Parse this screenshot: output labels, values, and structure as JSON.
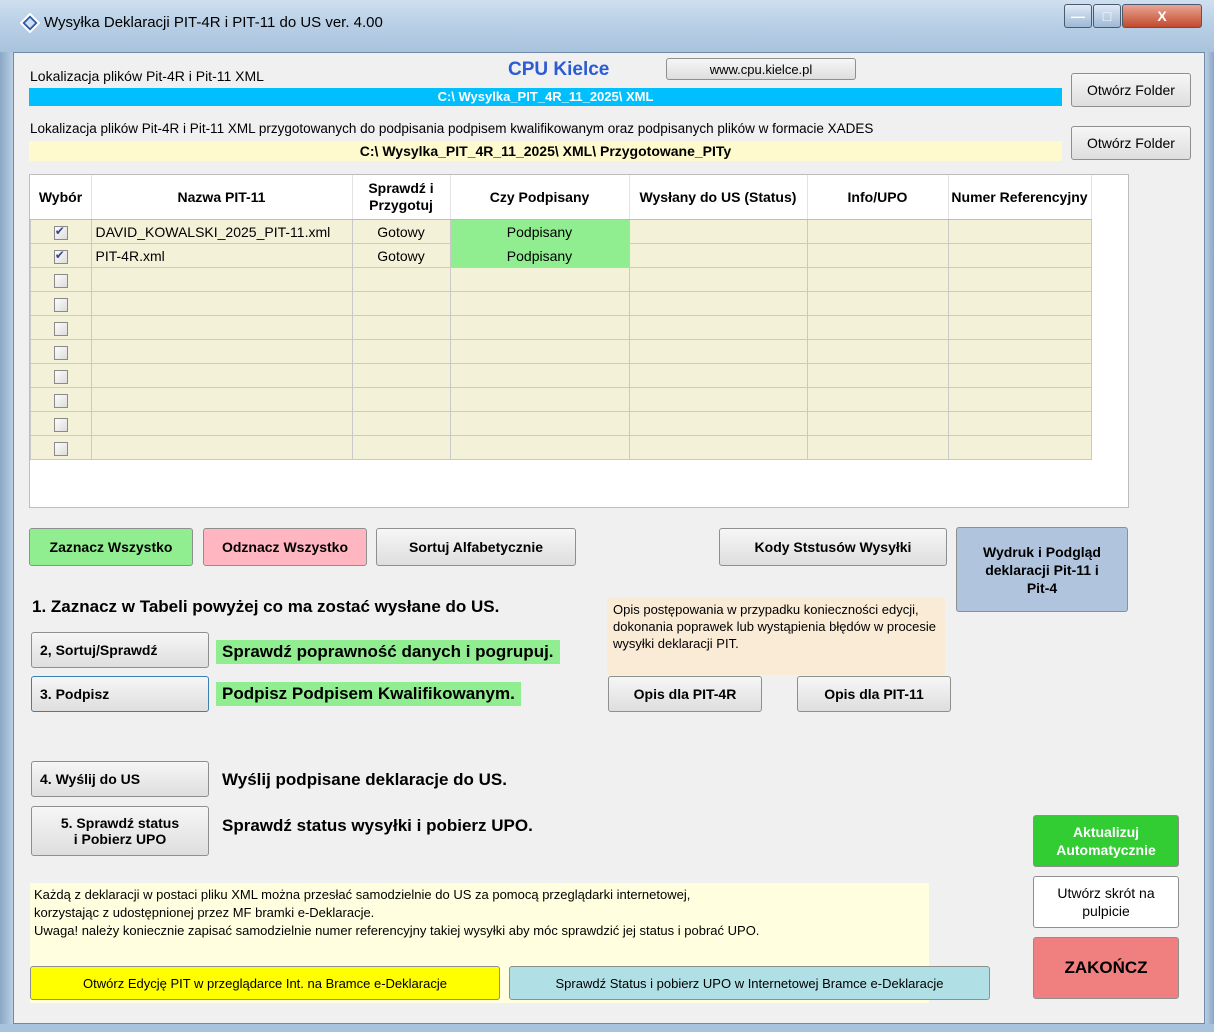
{
  "window": {
    "title": "Wysyłka Deklaracji PIT-4R i PIT-11 do US   ver. 4.00"
  },
  "header": {
    "brand": "CPU  Kielce",
    "website_button": "www.cpu.kielce.pl"
  },
  "paths": {
    "xml_label": "Lokalizacja plików Pit-4R i Pit-11 XML",
    "xml_path": "C:\\  Wysylka_PIT_4R_11_2025\\  XML",
    "signed_label": "Lokalizacja plików Pit-4R i Pit-11 XML przygotowanych do podpisania podpisem kwalifikowanym oraz podpisanych plików w formacie XADES",
    "signed_path": "C:\\  Wysylka_PIT_4R_11_2025\\  XML\\  Przygotowane_PITy",
    "open_folder_1": "Otwórz Folder",
    "open_folder_2": "Otwórz Folder"
  },
  "table": {
    "headers": {
      "wybor": "Wybór",
      "nazwa": "Nazwa PIT-11",
      "sprawdz": "Sprawdź i Przygotuj",
      "podpisany": "Czy Podpisany",
      "wyslany": "Wysłany do US (Status)",
      "info": "Info/UPO",
      "numer": "Numer Referencyjny"
    },
    "rows": [
      {
        "checked": true,
        "name": "DAVID_KOWALSKI_2025_PIT-11.xml",
        "prepared": "Gotowy",
        "signed": "Podpisany"
      },
      {
        "checked": true,
        "name": "PIT-4R.xml",
        "prepared": "Gotowy",
        "signed": "Podpisany"
      },
      {
        "checked": false,
        "name": "",
        "prepared": "",
        "signed": ""
      },
      {
        "checked": false,
        "name": "",
        "prepared": "",
        "signed": ""
      },
      {
        "checked": false,
        "name": "",
        "prepared": "",
        "signed": ""
      },
      {
        "checked": false,
        "name": "",
        "prepared": "",
        "signed": ""
      },
      {
        "checked": false,
        "name": "",
        "prepared": "",
        "signed": ""
      },
      {
        "checked": false,
        "name": "",
        "prepared": "",
        "signed": ""
      },
      {
        "checked": false,
        "name": "",
        "prepared": "",
        "signed": ""
      },
      {
        "checked": false,
        "name": "",
        "prepared": "",
        "signed": ""
      }
    ]
  },
  "buttons": {
    "select_all": "Zaznacz Wszystko",
    "deselect_all": "Odznacz Wszystko",
    "sort_alpha": "Sortuj Alfabetycznie",
    "status_codes": "Kody Ststusów Wysyłki",
    "print_preview": "Wydruk i Podgląd deklaracji Pit-11  i  Pit-4",
    "step2": "2,  Sortuj/Sprawdź",
    "step3": "3.  Podpisz",
    "step4": "4.  Wyślij do US",
    "step5": "5.  Sprawdź status i  Pobierz UPO",
    "desc_pit4r": "Opis dla PIT-4R",
    "desc_pit11": "Opis dla PIT-11",
    "update_auto": "Aktualizuj Automatycznie",
    "shortcut": "Utwórz skrót na pulpicie",
    "finish": "ZAKOŃCZ",
    "open_edit": "Otwórz Edycję PIT w przeglądarce Int. na Bramce e-Deklaracje",
    "check_status_web": "Sprawdź Status i pobierz UPO w Internetowej Bramce e-Deklaracje"
  },
  "steps": {
    "step1": "1.  Zaznacz w Tabeli powyżej co ma zostać wysłane do US.",
    "step2_desc": "Sprawdź poprawność danych i pogrupuj.",
    "step3_desc": "Podpisz Podpisem Kwalifikowanym.",
    "step4_desc": "Wyślij podpisane deklaracje do US.",
    "step5_desc": "Sprawdź status wysyłki i pobierz UPO."
  },
  "notes": {
    "procedure": "Opis postępowania w przypadku konieczności edycji, dokonania poprawek lub wystąpienia błędów w procesie wysyłki deklaracji PIT.",
    "bottom_1": "Każdą z deklaracji w postaci pliku XML można przesłać samodzielnie do US za pomocą przeglądarki internetowej,",
    "bottom_2": "korzystając z udostępnionej przez MF bramki e-Deklaracje.",
    "bottom_3": "Uwaga! należy koniecznie zapisać samodzielnie numer referencyjny takiej wysyłki aby móc sprawdzić jej status i pobrać UPO."
  }
}
